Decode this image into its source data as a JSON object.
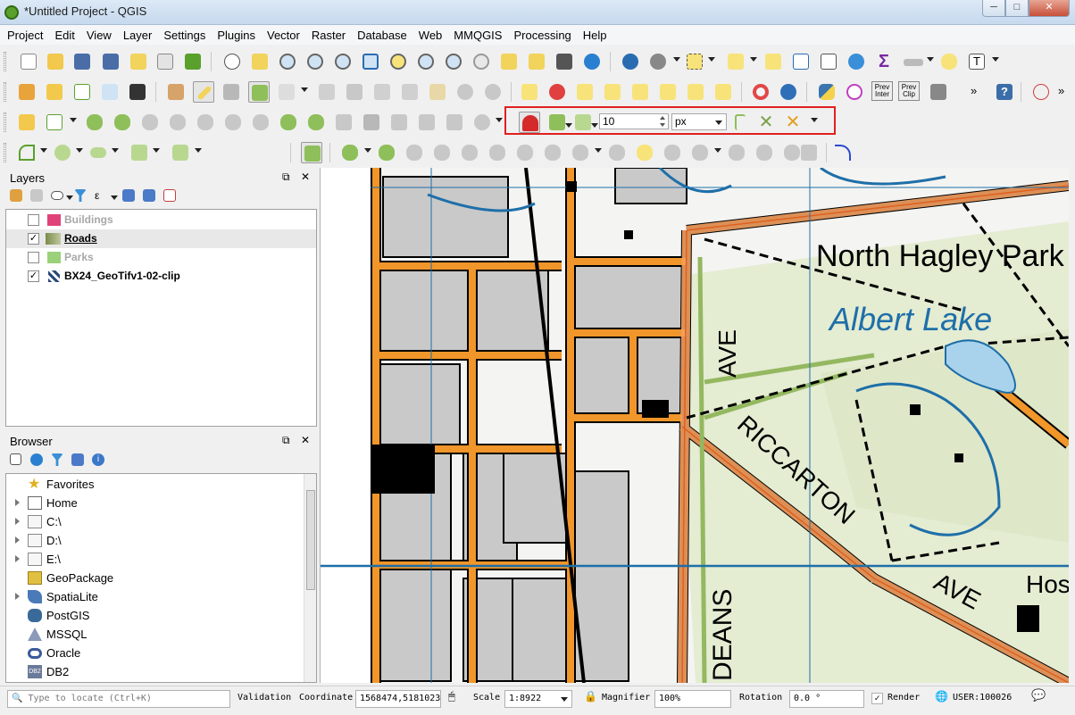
{
  "window": {
    "title": "*Untitled Project - QGIS",
    "minimize": "─",
    "maximize": "□",
    "close": "✕"
  },
  "menu": [
    "Project",
    "Edit",
    "View",
    "Layer",
    "Settings",
    "Plugins",
    "Vector",
    "Raster",
    "Database",
    "Web",
    "MMQGIS",
    "Processing",
    "Help"
  ],
  "snapping": {
    "tolerance": "10",
    "unit": "px"
  },
  "toolbar_labels": {
    "prev_inter": "Prev Inter",
    "prev_clip": "Prev Clip",
    "help": "?"
  },
  "layers_panel": {
    "title": "Layers",
    "layers": [
      {
        "name": "Buildings",
        "checked": false,
        "color": "#e0437a"
      },
      {
        "name": "Roads",
        "checked": true,
        "color": "#7a8c4a"
      },
      {
        "name": "Parks",
        "checked": false,
        "color": "#9bd17a"
      },
      {
        "name": "BX24_GeoTifv1-02-clip",
        "checked": true,
        "color": "#3a3a3a"
      }
    ]
  },
  "browser_panel": {
    "title": "Browser",
    "items": [
      {
        "name": "Favorites",
        "icon": "star-icon"
      },
      {
        "name": "Home",
        "icon": "home-icon"
      },
      {
        "name": "C:\\",
        "icon": "folder-icon"
      },
      {
        "name": "D:\\",
        "icon": "folder-icon"
      },
      {
        "name": "E:\\",
        "icon": "folder-icon"
      },
      {
        "name": "GeoPackage",
        "icon": "geopackage-icon"
      },
      {
        "name": "SpatiaLite",
        "icon": "spatialite-icon"
      },
      {
        "name": "PostGIS",
        "icon": "postgis-icon"
      },
      {
        "name": "MSSQL",
        "icon": "mssql-icon"
      },
      {
        "name": "Oracle",
        "icon": "oracle-icon"
      },
      {
        "name": "DB2",
        "icon": "db2-icon"
      }
    ]
  },
  "map_labels": {
    "north_hagley": "North Hagley Park",
    "albert_lake": "Albert Lake",
    "ave_v": "AVE",
    "riccarton": "RICCARTON",
    "ave2": "AVE",
    "hos": "Hos",
    "deans": "DEANS"
  },
  "status": {
    "locate_placeholder": "Type to locate (Ctrl+K)",
    "validation": "Validation",
    "coordinate_label": "Coordinate",
    "coordinate": "1568474,5181023",
    "scale_label": "Scale",
    "scale": "1:8922",
    "magnifier_label": "Magnifier",
    "magnifier": "100%",
    "rotation_label": "Rotation",
    "rotation": "0.0 °",
    "render_label": "Render",
    "crs": "USER:100026"
  },
  "colors": {
    "accent_red": "#e02020",
    "road_orange": "#f0962a",
    "park_green": "#dfe8c8",
    "water_blue": "#1e6fa8"
  }
}
